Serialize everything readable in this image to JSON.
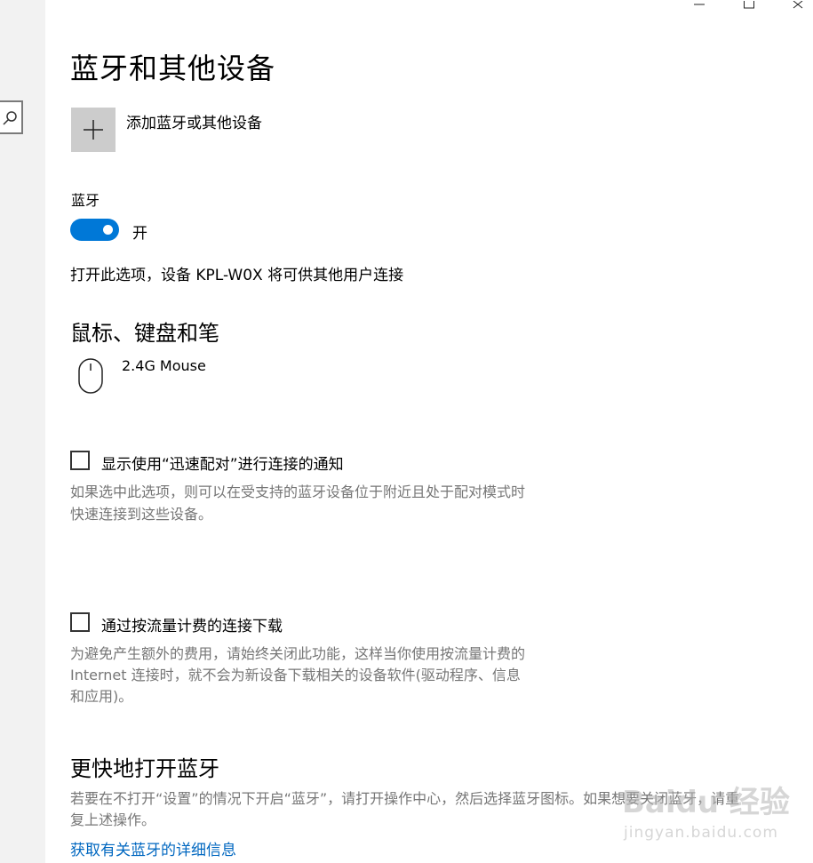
{
  "page": {
    "title": "蓝牙和其他设备"
  },
  "add_device": {
    "label": "添加蓝牙或其他设备",
    "icon": "plus-icon"
  },
  "bluetooth": {
    "label": "蓝牙",
    "toggle_on": true,
    "state_text": "开",
    "accent_color": "#0078d7",
    "description": "打开此选项，设备 KPL-W0X 将可供其他用户连接"
  },
  "mice_section": {
    "heading": "鼠标、键盘和笔",
    "devices": [
      {
        "name": "2.4G Mouse",
        "icon": "mouse-icon"
      }
    ]
  },
  "swift_pair": {
    "checked": false,
    "label": "显示使用“迅速配对”进行连接的通知",
    "desc_line1": "如果选中此选项，则可以在受支持的蓝牙设备位于附近且处于配对模式时",
    "desc_line2": "快速连接到这些设备。"
  },
  "metered": {
    "checked": false,
    "label": "通过按流量计费的连接下载",
    "desc_line1": "为避免产生额外的费用，请始终关闭此功能，这样当你使用按流量计费的",
    "desc_line2": "Internet 连接时，就不会为新设备下载相关的设备软件(驱动程序、信息",
    "desc_line3": "和应用)。"
  },
  "faster": {
    "heading": "更快地打开蓝牙",
    "desc_line1": "若要在不打开“设置”的情况下开启“蓝牙”，请打开操作中心，然后选择蓝牙图标。如果想要关闭蓝牙，请重",
    "desc_line2": "复上述操作。",
    "link": "获取有关蓝牙的详细信息",
    "link_color": "#0067c0"
  },
  "watermark": {
    "main": "Baidu 经验",
    "sub": "jingyan.baidu.com"
  }
}
